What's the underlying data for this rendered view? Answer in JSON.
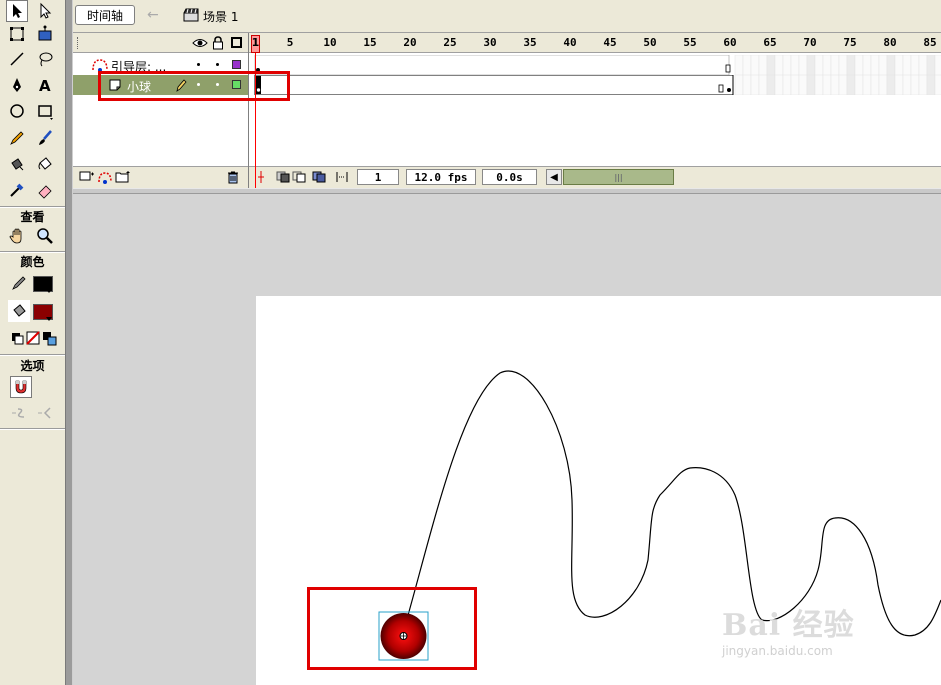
{
  "timeline_bar": {
    "timeline_button": "时间轴",
    "scene_label": "场景 1"
  },
  "tools_panel": {
    "view_title": "查看",
    "colors_title": "颜色",
    "options_title": "选项",
    "stroke_color": "#000000",
    "fill_color": "#8b0000"
  },
  "layers": [
    {
      "name": "引导层: ...",
      "type": "guide",
      "color": "#9933cc"
    },
    {
      "name": "小球",
      "type": "normal",
      "color": "#66dd66"
    }
  ],
  "ruler_numbers": [
    "1",
    "5",
    "10",
    "15",
    "20",
    "25",
    "30",
    "35",
    "40",
    "45",
    "50",
    "55",
    "60",
    "65",
    "70",
    "75",
    "80",
    "85"
  ],
  "status": {
    "current_frame": "1",
    "frame_rate": "12.0 fps",
    "elapsed_time": "0.0s"
  },
  "watermark": {
    "brand": "Bai 经验",
    "url": "jingyan.baidu.com"
  }
}
